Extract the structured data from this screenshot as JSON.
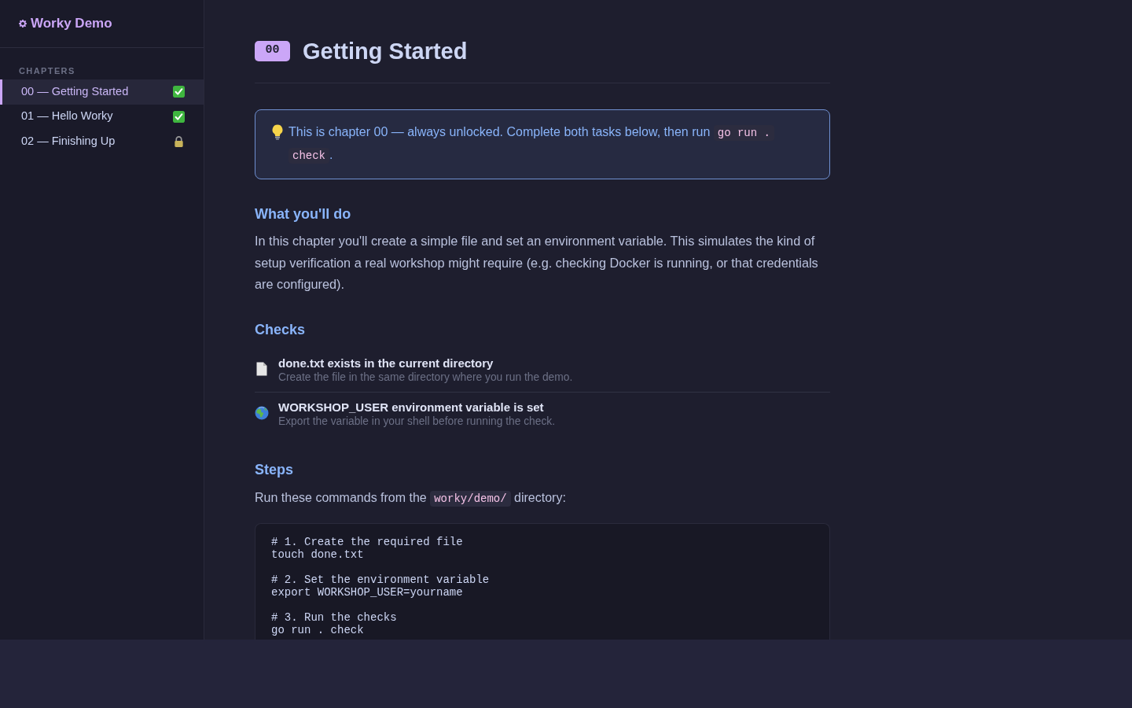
{
  "sidebar": {
    "brand": "Worky Demo",
    "section_label": "CHAPTERS",
    "chapters": [
      {
        "label": "00 — Getting Started",
        "selected": true,
        "kind": "completed"
      },
      {
        "label": "01 — Hello Worky",
        "selected": false,
        "kind": "completed"
      },
      {
        "label": "02 — Finishing Up",
        "selected": false,
        "kind": "locked"
      }
    ]
  },
  "page": {
    "badge": "00",
    "title": "Getting Started",
    "callout": [
      {
        "kind": "text",
        "text": "This is chapter 00 — always unlocked. Complete both tasks below, then run "
      },
      {
        "kind": "code",
        "text": "go run . check"
      },
      {
        "kind": "text",
        "text": "."
      }
    ],
    "sections": [
      {
        "kind": "text",
        "heading": "What you'll do",
        "body": "In this chapter you'll create a simple file and set an environment variable. This simulates the kind of setup verification a real workshop might require (e.g. checking Docker is running, or that credentials are configured)."
      },
      {
        "kind": "checks",
        "heading": "Checks",
        "items": [
          {
            "kind": "file",
            "title": "done.txt exists in the current directory",
            "description": "Create the file in the same directory where you run the demo."
          },
          {
            "kind": "env",
            "title": "WORKSHOP_USER environment variable is set",
            "description": "Export the variable in your shell before running the check."
          }
        ]
      },
      {
        "kind": "steps",
        "heading": "Steps",
        "intro": [
          {
            "kind": "text",
            "text": "Run these commands from the "
          },
          {
            "kind": "code",
            "text": "worky/demo/"
          },
          {
            "kind": "text",
            "text": " directory:"
          }
        ],
        "code": [
          [
            "# 1. Create the required file",
            "touch done.txt"
          ],
          [
            "# 2. Set the environment variable",
            "export WORKSHOP_USER=yourname"
          ],
          [
            "# 3. Run the checks",
            "go run . check"
          ]
        ]
      }
    ]
  }
}
